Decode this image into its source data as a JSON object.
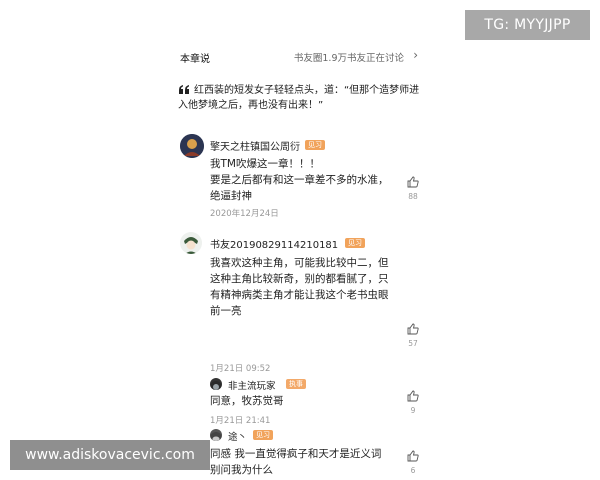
{
  "watermarks": {
    "top_right": "TG: MYYJJPP",
    "bottom_left": "www.adiskovacevic.com"
  },
  "header": {
    "title": "本章说",
    "count_text": "书友圈1.9万书友正在讨论",
    "chevron": "chevron-right-icon"
  },
  "quote": {
    "icon": "quote-icon",
    "text": "红西装的短发女子轻轻点头，道：“但那个造梦师进入他梦境之后，再也没有出来！”"
  },
  "comments": [
    {
      "username": "擎天之柱镇国公周衍",
      "badge": "见习",
      "badge_color": "#f1a35b",
      "text": "我TM吹爆这一章！！！\n要是之后都有和这一章差不多的水准，绝逼封神",
      "date": "2020年12月24日",
      "likes": "88",
      "avatar": "avatar-icon"
    },
    {
      "username": "书友20190829114210181",
      "badge": "见习",
      "badge_color": "#f1a35b",
      "text": "我喜欢这种主角，可能我比较中二，但这种主角比较新奇，别的都看腻了，只有精神病类主角才能让我这个老书虫眼前一亮",
      "date": "1月21日 09:52",
      "likes": "57",
      "avatar": "avatar-icon"
    }
  ],
  "replies": [
    {
      "username": "非主流玩家",
      "badge": "执事",
      "badge_color": "#f3a969",
      "text": "同意，牧苏觉哥",
      "date": "1月21日 21:41",
      "likes": "9"
    },
    {
      "username": "途丶",
      "badge": "见习",
      "badge_color": "#f1a35b",
      "text": "同感  我一直觉得疯子和天才是近义词  别问我为什么",
      "likes": "6"
    }
  ]
}
